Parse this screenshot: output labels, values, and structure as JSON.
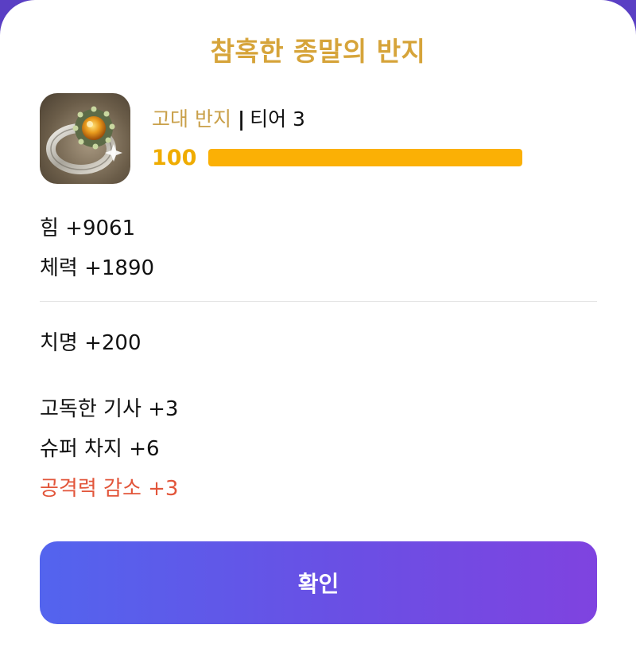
{
  "dialog": {
    "title": "참혹한 종말의 반지",
    "item_type": "고대 반지",
    "separator": "|",
    "tier": "티어 3",
    "level": "100",
    "progress_fraction": 1.0,
    "icon": "ring-icon"
  },
  "stats_primary": [
    {
      "text": "힘 +9061"
    },
    {
      "text": "체력 +1890"
    }
  ],
  "stats_secondary": [
    {
      "text": "치명 +200"
    }
  ],
  "effects": [
    {
      "text": "고독한 기사 +3"
    },
    {
      "text": "슈퍼 차지 +6"
    },
    {
      "text": "공격력 감소 +3"
    }
  ],
  "colors": {
    "title": "#d6a43a",
    "item_type": "#c9a04a",
    "level": "#efac00",
    "progress": "#fbb005",
    "negative_effect": "#e2553a",
    "button_start": "#5364ee",
    "button_end": "#7f43e0"
  },
  "confirm_button": {
    "label": "확인"
  }
}
